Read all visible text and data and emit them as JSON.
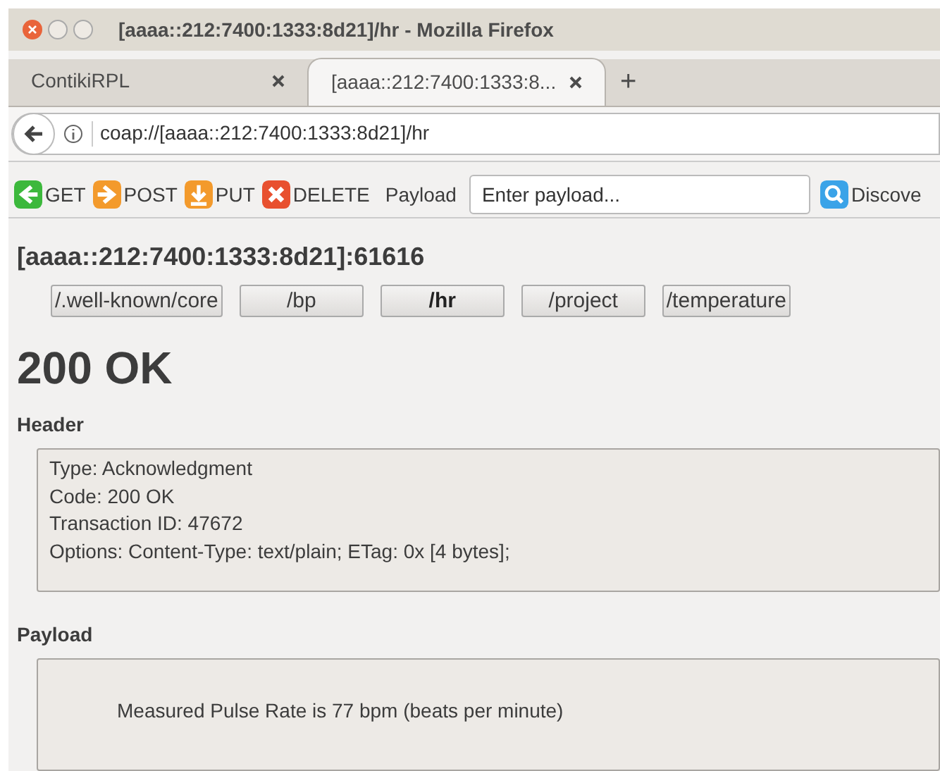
{
  "window": {
    "title": "[aaaa::212:7400:1333:8d21]/hr - Mozilla Firefox"
  },
  "tabs": [
    {
      "label": "ContikiRPL",
      "selected": false
    },
    {
      "label": "[aaaa::212:7400:1333:8...",
      "selected": true
    }
  ],
  "new_tab": "+",
  "url": "coap://[aaaa::212:7400:1333:8d21]/hr",
  "toolbar": {
    "methods": [
      {
        "kind": "get",
        "label": "GET"
      },
      {
        "kind": "post",
        "label": "POST"
      },
      {
        "kind": "put",
        "label": "PUT"
      },
      {
        "kind": "delete",
        "label": "DELETE"
      }
    ],
    "payload_label": "Payload",
    "payload_field": {
      "placeholder": "Enter payload..."
    },
    "discover": "Discove"
  },
  "host": "[aaaa::212:7400:1333:8d21]:61616",
  "resources": [
    {
      "label": "/.well-known/core",
      "selected": false
    },
    {
      "label": "/bp",
      "selected": false
    },
    {
      "label": "/hr",
      "selected": true
    },
    {
      "label": "/project",
      "selected": false
    },
    {
      "label": "/temperature",
      "selected": false
    }
  ],
  "status": "200 OK",
  "header": {
    "title": "Header",
    "lines": [
      "Type: Acknowledgment",
      "Code: 200 OK",
      "Transaction ID: 47672",
      "Options: Content-Type: text/plain; ETag: 0x [4 bytes];"
    ]
  },
  "payload": {
    "title": "Payload",
    "text": "Measured Pulse Rate is 77 bpm (beats per minute)"
  }
}
